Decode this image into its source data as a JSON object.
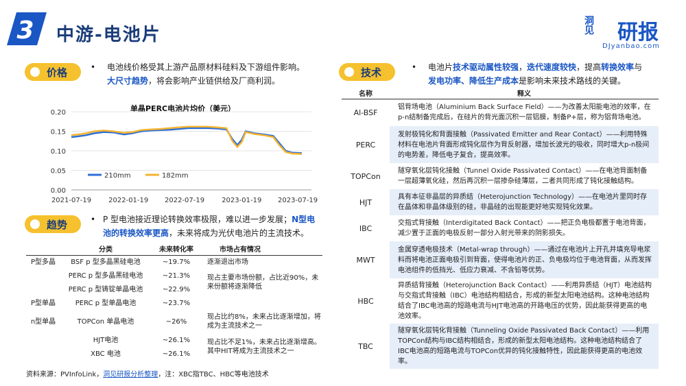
{
  "header": {
    "section_number": "3",
    "title": "中游-电池片",
    "logo": "研报",
    "logo_mark": "洞见",
    "logo_sub": "DJyanbao.com"
  },
  "price": {
    "tag": "价格",
    "bullet": "•",
    "text_1": "电池线价格受其上游产品原材料硅料及下游组件影响。",
    "text_2_hl": "大尺寸趋势",
    "text_2_rest": "，将会影响产业链供给及厂商利润。"
  },
  "trend": {
    "tag": "趋势",
    "bullet": "•",
    "text_a": "P 型电池接近理论转换效率极限，难以进一步发展；",
    "text_b_hl": "N型电池的转换效率更高",
    "text_c": "，未来将成为光伏电池片的主流技术。",
    "headers": [
      "分类",
      "未来转化率",
      "市场占有情况"
    ],
    "rows": [
      {
        "group": "P型多晶",
        "type": "BSF p 型多晶黑硅电池",
        "rate": "~19.7%"
      },
      {
        "group": "",
        "type": "PERC p 型多晶黑硅电池",
        "rate": "~21.3%"
      },
      {
        "group": "",
        "type": "PERC p 型铸锭单晶电池",
        "rate": "~22.9%"
      },
      {
        "group": "P型单晶",
        "type": "PERC p 型单晶电池",
        "rate": "~23.7%"
      },
      {
        "group": "n型单晶",
        "type": "TOPCon 单晶电池",
        "rate": "~26%"
      },
      {
        "group": "",
        "type": "HJT电池",
        "rate": "~26.1%"
      },
      {
        "group": "",
        "type": "XBC 电池",
        "rate": "~26.1%"
      }
    ],
    "share": [
      "逐渐退出市场",
      "现占主要市场份额，占比近90%，未来份额将逐渐降低",
      "现占比约8%，未来占比逐渐增加，将成为主流技术之一",
      "现占比不足1%，未来占比逐渐增高。其中HIT将成为主流技术之一"
    ]
  },
  "source": {
    "prefix": "资料来源：PVInfoLink，",
    "link": "洞见研报分析整理",
    "suffix": "，注：XBC指TBC、HBC等电池技术"
  },
  "tech": {
    "tag": "技术",
    "bullet": "•",
    "t1": "电池片",
    "t2_hl": "技术驱动属性较强",
    "t3": "，",
    "t4_hl": "迭代速度较快",
    "t5": "，提高",
    "t6_hl": "转换效率",
    "t7": "与",
    "t8_hl": "发电功率、降低生产成本",
    "t9": "是影响未来技术路线的关键。",
    "headers": [
      "名称",
      "释义"
    ],
    "rows": [
      {
        "name": "Al-BSF",
        "desc": "铝背场电池（Aluminium Back Surface Field）——为改善太阳能电池的效率，在p-n结制备完成后，在硅片的背光面沉积一层铝膜，制备P+层，称为铝背场电池。"
      },
      {
        "name": "PERC",
        "desc": "发射极钝化和背面接触（Passivated Emitter and Rear Contact）——利用特殊材料在电池片背面形成钝化层作为背反射器，增加长波光的吸收，同时增大p-n极间的电势差，降低电子复合，提高效率。"
      },
      {
        "name": "TOPCon",
        "desc": "隧穿氧化层钝化接触（Tunnel Oxide Passivated Contact）——在电池背面制备一层超薄氧化硅，然后再沉积一层掺杂硅薄层，二者共同形成了钝化接触结构。"
      },
      {
        "name": "HJT",
        "desc": "具有本征非晶层的异质结（Heterojunction Technology）——在电池片里同时存在晶体和非晶体级别的硅，非晶硅的出现能更好地实现钝化效果。"
      },
      {
        "name": "IBC",
        "desc": "交指式背接触（Interdigitated Back Contact）——把正负电极都置于电池背面，减少置于正面的电极反射一部分入射光带来的阴影损失。"
      },
      {
        "name": "MWT",
        "desc": "金属穿透电极技术（Metal-wrap through）——通过在电池片上开孔并填充导电浆料而将电池正面电极引到背面，使得电池片的正、负电极均位于电池背面，从而发挥电池组件的低挡光、低应力衰减、不含铅等优势。"
      },
      {
        "name": "HBC",
        "desc": "异质结背接触（Heterojunction Back Contact）——利用异质结（HJT）电池结构与交指式背接触（IBC）电池结构相结合，形成的新型太阳电池结构。这种电池结构结合了IBC电池高的短路电流与HJT电池高的开路电压的优势，因此能获得更高的电池效率。"
      },
      {
        "name": "TBC",
        "desc": "隧穿氧化层钝化背接触（Tunneling Oxide Passivated Back Contact）——利用TOPCon结构与IBC结构相结合，形成的新型太阳电池结构。这种电池结构结合了IBC电池高的短路电流与TOPCon优异的钝化接触特性，因此能获得更高的电池效率。"
      }
    ]
  },
  "chart_data": {
    "type": "line",
    "title": "单晶PERC电池片均价（美元）",
    "xlabel": "",
    "ylabel": "",
    "x_ticks": [
      "2021-07-19",
      "2022-01-19",
      "2022-07-19",
      "2023-01-19",
      "2023-07-19"
    ],
    "y_ticks": [
      "0.00",
      "0.05",
      "0.10",
      "0.15",
      "0.20"
    ],
    "ylim": [
      0,
      0.2
    ],
    "xlim": [
      "2021-07-19",
      "2023-09-01"
    ],
    "legend_position": "bottom-left",
    "series": [
      {
        "name": "210mm",
        "color": "#2e6fd8",
        "points": [
          [
            "2021-07-19",
            0.135
          ],
          [
            "2021-08-10",
            0.137
          ],
          [
            "2021-09-05",
            0.14
          ],
          [
            "2021-10-01",
            0.145
          ],
          [
            "2021-11-01",
            0.148
          ],
          [
            "2021-12-01",
            0.147
          ],
          [
            "2022-01-05",
            0.142
          ],
          [
            "2022-02-01",
            0.145
          ],
          [
            "2022-03-01",
            0.15
          ],
          [
            "2022-04-01",
            0.152
          ],
          [
            "2022-05-01",
            0.153
          ],
          [
            "2022-06-01",
            0.154
          ],
          [
            "2022-07-01",
            0.156
          ],
          [
            "2022-08-01",
            0.158
          ],
          [
            "2022-09-01",
            0.158
          ],
          [
            "2022-10-01",
            0.158
          ],
          [
            "2022-11-01",
            0.157
          ],
          [
            "2022-12-01",
            0.155
          ],
          [
            "2022-12-20",
            0.13
          ],
          [
            "2023-01-05",
            0.115
          ],
          [
            "2023-01-19",
            0.128
          ],
          [
            "2023-02-01",
            0.15
          ],
          [
            "2023-03-01",
            0.145
          ],
          [
            "2023-04-01",
            0.142
          ],
          [
            "2023-05-01",
            0.138
          ],
          [
            "2023-05-20",
            0.12
          ],
          [
            "2023-06-10",
            0.1
          ],
          [
            "2023-07-01",
            0.095
          ],
          [
            "2023-08-01",
            0.094
          ]
        ]
      },
      {
        "name": "182mm",
        "color": "#f4b431",
        "points": [
          [
            "2021-07-19",
            0.14
          ],
          [
            "2021-08-10",
            0.142
          ],
          [
            "2021-09-05",
            0.145
          ],
          [
            "2021-10-01",
            0.15
          ],
          [
            "2021-11-01",
            0.152
          ],
          [
            "2021-12-01",
            0.15
          ],
          [
            "2022-01-05",
            0.146
          ],
          [
            "2022-02-01",
            0.148
          ],
          [
            "2022-03-01",
            0.153
          ],
          [
            "2022-04-01",
            0.155
          ],
          [
            "2022-05-01",
            0.156
          ],
          [
            "2022-06-01",
            0.158
          ],
          [
            "2022-07-01",
            0.16
          ],
          [
            "2022-08-01",
            0.162
          ],
          [
            "2022-09-01",
            0.162
          ],
          [
            "2022-10-01",
            0.162
          ],
          [
            "2022-11-01",
            0.16
          ],
          [
            "2022-12-01",
            0.158
          ],
          [
            "2022-12-20",
            0.125
          ],
          [
            "2023-01-05",
            0.11
          ],
          [
            "2023-01-19",
            0.122
          ],
          [
            "2023-02-01",
            0.148
          ],
          [
            "2023-03-01",
            0.143
          ],
          [
            "2023-04-01",
            0.14
          ],
          [
            "2023-05-01",
            0.135
          ],
          [
            "2023-05-20",
            0.115
          ],
          [
            "2023-06-10",
            0.097
          ],
          [
            "2023-07-01",
            0.093
          ],
          [
            "2023-08-01",
            0.092
          ]
        ]
      }
    ]
  }
}
